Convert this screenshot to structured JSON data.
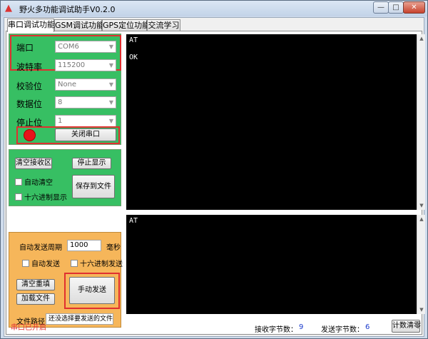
{
  "window": {
    "title": "野火多功能调试助手V0.2.0",
    "min_glyph": "—",
    "max_glyph": "□",
    "close_glyph": "✕",
    "icon_glyph": "▲"
  },
  "tabs": [
    {
      "label": "串口调试功能",
      "active": true
    },
    {
      "label": "GSM调试功能",
      "active": false
    },
    {
      "label": "GPS定位功能",
      "active": false
    },
    {
      "label": "交流学习",
      "active": false
    }
  ],
  "serial_settings": {
    "port_label": "端口",
    "port_value": "COM6",
    "baud_label": "波特率",
    "baud_value": "115200",
    "parity_label": "校验位",
    "parity_value": "None",
    "databits_label": "数据位",
    "databits_value": "8",
    "stopbits_label": "停止位",
    "stopbits_value": "1",
    "close_port_button": "关闭串口",
    "led_color": "#e8141b"
  },
  "receive_controls": {
    "clear_receive_button": "清空接收区",
    "stop_display_button": "停止显示",
    "auto_clear_label": "自动清空",
    "hex_display_label": "十六进制显示",
    "save_to_file_button": "保存到文件"
  },
  "send_controls": {
    "auto_send_period_label": "自动发送周期",
    "period_value": "1000",
    "period_unit": "毫秒",
    "auto_send_label": "自动发送",
    "hex_send_label": "十六进制发送",
    "clear_refill_button": "清空重填",
    "load_file_button": "加载文件",
    "manual_send_button": "手动发送",
    "file_path_label": "文件路径",
    "file_path_value": "还没选择要发送的文件"
  },
  "receive_terminal": {
    "lines": [
      "AT",
      "",
      "OK"
    ]
  },
  "send_terminal": {
    "lines": [
      "AT"
    ]
  },
  "status": {
    "port_state": "串口已开启",
    "rx_label": "接收字节数：",
    "rx_count": "9",
    "tx_label": "发送字节数：",
    "tx_count": "6",
    "clear_counts_button": "计数清零"
  },
  "colors": {
    "green_panel": "#37bf63",
    "orange_panel": "#f6b65a",
    "highlight_border": "#e03030",
    "terminal_bg": "#000000"
  }
}
